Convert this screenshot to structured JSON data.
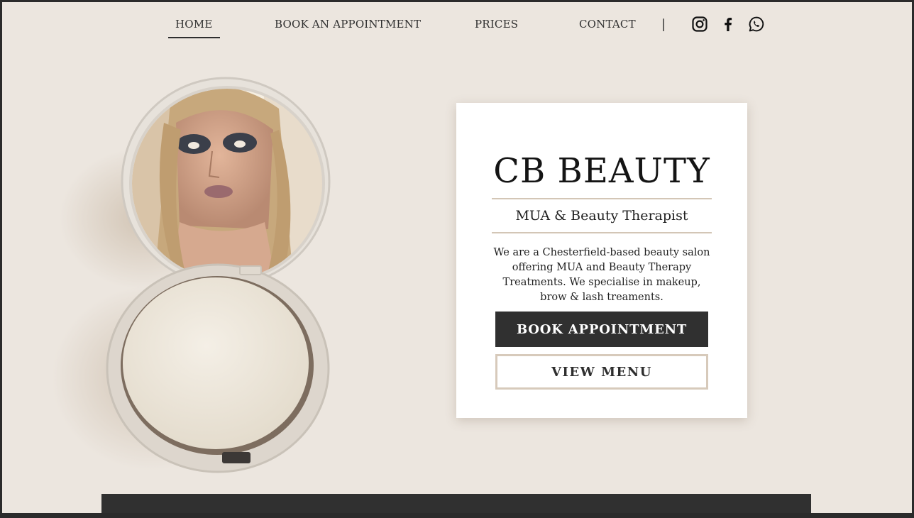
{
  "nav": {
    "items": [
      {
        "label": "HOME",
        "active": true
      },
      {
        "label": "BOOK AN APPOINTMENT",
        "active": false
      },
      {
        "label": "PRICES",
        "active": false
      },
      {
        "label": "CONTACT",
        "active": false
      }
    ],
    "separator": "|",
    "social": [
      "instagram-icon",
      "facebook-icon",
      "whatsapp-icon"
    ]
  },
  "hero": {
    "title": "CB BEAUTY",
    "subtitle": "MUA & Beauty Therapist",
    "description": "We are a Chesterfield-based beauty salon offering MUA and Beauty Therapy Treatments. We specialise in makeup, brow & lash treaments.",
    "book_button": "BOOK APPOINTMENT",
    "menu_button": "VIEW MENU"
  },
  "colors": {
    "background": "#ece6df",
    "accent": "#d3c6b6",
    "dark": "#303030"
  }
}
